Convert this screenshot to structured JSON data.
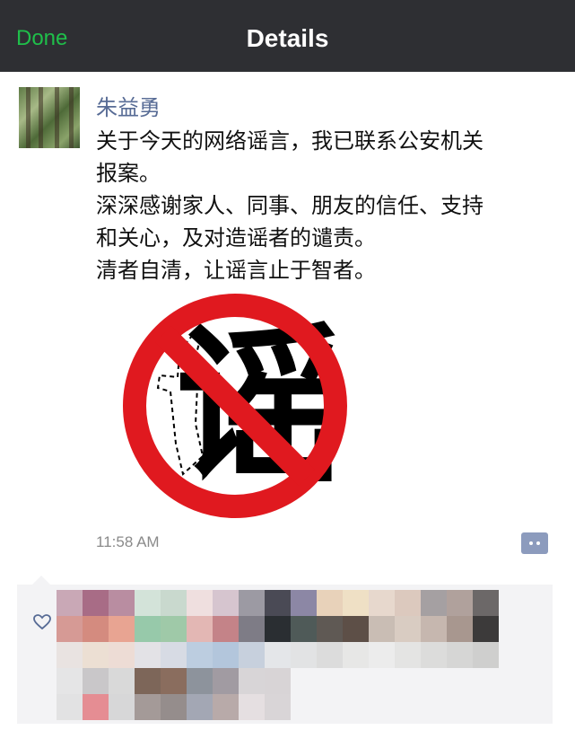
{
  "nav": {
    "done_label": "Done",
    "title": "Details"
  },
  "post": {
    "author": "朱益勇",
    "lines": [
      "关于今天的网络谣言，我已联系公安机关",
      "报案。",
      "深深感谢家人、同事、朋友的信任、支持",
      "和关心，及对造谣者的谴责。",
      "清者自清，让谣言止于智者。"
    ],
    "image": {
      "icon": "no-rumor-sign-icon",
      "glyph": "谣",
      "ring_color": "#e0191f"
    },
    "timestamp": "11:58 AM"
  },
  "likes": {
    "icon": "heart-outline-icon",
    "avatar_colors": [
      [
        "#c9a8b6",
        "#a86c86",
        "#b98da1",
        "#d3e3d9",
        "#c9d9ce",
        "#efdfdf",
        "#d6c5cf",
        "#9c9aa3",
        "#4a4a55",
        "#8c87a5",
        "#e8d2ba",
        "#efe0c5",
        "#e7d8cd",
        "#dcc9be",
        "#a5a0a2",
        "#b0a19c",
        "#6c6868"
      ],
      [
        "#d69a95",
        "#d48b7f",
        "#e8a492",
        "#97c9aa",
        "#9fc9a8",
        "#e3b7b4",
        "#c48388",
        "#7e7c86",
        "#2a2e32",
        "#4f5a58",
        "#5f5954",
        "#5d4f47",
        "#c9bdb4",
        "#d9ccc2",
        "#c6b7af",
        "#a8978f",
        "#3c3a3a"
      ],
      [
        "#e9e3e1",
        "#ecdfd3",
        "#eddcd5",
        "#e3e2e6",
        "#d7dbe4",
        "#bccde0",
        "#b3c6dc",
        "#c7d0dd",
        "#e4e6e9",
        "#e2e3e4",
        "#dcdcdc",
        "#e7e7e6",
        "#ececec",
        "#e4e4e3",
        "#dcdcdb",
        "#d6d6d5",
        "#cfcfce"
      ],
      [
        "#e5e5e6",
        "#c9c7c9",
        "#d9d9d9",
        "#7d6659",
        "#8a6d5e",
        "#8d939c",
        "#a19ba2",
        "#d8d5d7",
        "#d8d4d6"
      ],
      [
        "#e2e2e3",
        "#e58d93",
        "#d7d7d8",
        "#a49a98",
        "#958d8c",
        "#a3a7b4",
        "#b8aaa9",
        "#e5dfe1",
        "#d9d5d7"
      ]
    ]
  }
}
